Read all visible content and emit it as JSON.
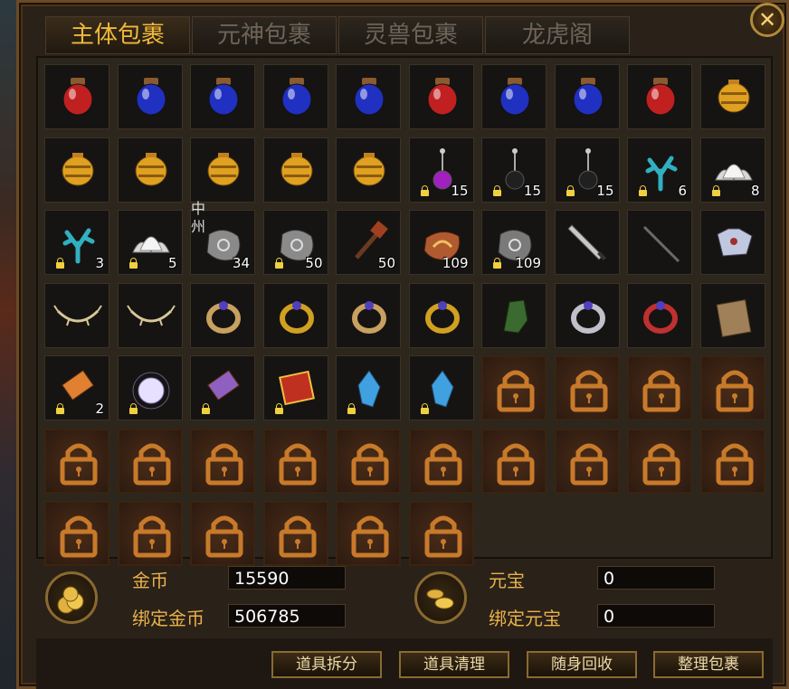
{
  "tabs": [
    "主体包裹",
    "元神包裹",
    "灵兽包裹",
    "龙虎阁"
  ],
  "active_tab": 0,
  "close_label": "✕",
  "items": [
    {
      "icon": "red-potion-icon",
      "color": "#c02020",
      "count": "",
      "bound": false
    },
    {
      "icon": "blue-potion-icon",
      "color": "#2030c0",
      "count": "",
      "bound": false
    },
    {
      "icon": "blue-potion-icon",
      "color": "#2030c0",
      "count": "",
      "bound": false
    },
    {
      "icon": "blue-potion-icon",
      "color": "#2030c0",
      "count": "",
      "bound": false
    },
    {
      "icon": "blue-potion-icon",
      "color": "#2030c0",
      "count": "",
      "bound": false
    },
    {
      "icon": "red-potion-icon",
      "color": "#c02020",
      "count": "",
      "bound": false
    },
    {
      "icon": "blue-potion-icon",
      "color": "#2030c0",
      "count": "",
      "bound": false
    },
    {
      "icon": "blue-potion-icon",
      "color": "#2030c0",
      "count": "",
      "bound": false
    },
    {
      "icon": "red-potion-icon",
      "color": "#c02020",
      "count": "",
      "bound": false
    },
    {
      "icon": "gold-jar-icon",
      "color": "#e0a020",
      "count": "",
      "bound": false
    },
    {
      "icon": "gold-jar-icon",
      "color": "#e0a020",
      "count": "",
      "bound": false
    },
    {
      "icon": "gold-jar-icon",
      "color": "#e0a020",
      "count": "",
      "bound": false
    },
    {
      "icon": "gold-jar-icon",
      "color": "#e0a020",
      "count": "",
      "bound": false
    },
    {
      "icon": "gold-jar-icon",
      "color": "#e0a020",
      "count": "",
      "bound": false
    },
    {
      "icon": "gold-jar-icon",
      "color": "#e0a020",
      "count": "",
      "bound": false
    },
    {
      "icon": "purple-flask-icon",
      "color": "#a020c0",
      "count": "15",
      "bound": true
    },
    {
      "icon": "black-flask-icon",
      "color": "#202020",
      "count": "15",
      "bound": true
    },
    {
      "icon": "black-flask-icon",
      "color": "#202020",
      "count": "15",
      "bound": true
    },
    {
      "icon": "coral-icon",
      "color": "#30b0c0",
      "count": "6",
      "bound": true
    },
    {
      "icon": "lotus-icon",
      "color": "#d8d8d8",
      "count": "8",
      "bound": true
    },
    {
      "icon": "coral-icon",
      "color": "#30b0c0",
      "count": "3",
      "bound": true
    },
    {
      "icon": "lotus-icon",
      "color": "#d8d8d8",
      "count": "5",
      "bound": true
    },
    {
      "icon": "stone-tablet-icon",
      "color": "#8a8a8a",
      "count": "34",
      "bound": false
    },
    {
      "icon": "stone-tablet-icon",
      "color": "#8a8a8a",
      "count": "50",
      "bound": true
    },
    {
      "icon": "hammer-icon",
      "color": "#a04020",
      "count": "50",
      "bound": false
    },
    {
      "icon": "orange-rune-stone-icon",
      "color": "#b05a30",
      "count": "109",
      "bound": false
    },
    {
      "icon": "gray-rune-stone-icon",
      "color": "#7a7a7a",
      "count": "109",
      "bound": true
    },
    {
      "icon": "sword-icon",
      "color": "#c8c8c8",
      "count": "",
      "bound": false
    },
    {
      "icon": "staff-icon",
      "color": "#6a6a6a",
      "count": "",
      "bound": false
    },
    {
      "icon": "armor-icon",
      "color": "#c0c8e0",
      "count": "",
      "bound": false
    },
    {
      "icon": "thorn-necklace-icon",
      "color": "#d8c898",
      "count": "",
      "bound": false
    },
    {
      "icon": "thorn-necklace-icon",
      "color": "#d8c898",
      "count": "",
      "bound": false
    },
    {
      "icon": "skull-ring-icon",
      "color": "#c8a060",
      "count": "",
      "bound": false
    },
    {
      "icon": "gold-ring-icon",
      "color": "#d0a020",
      "count": "",
      "bound": false
    },
    {
      "icon": "skull-ring-icon",
      "color": "#c8a060",
      "count": "",
      "bound": false
    },
    {
      "icon": "gold-bracelet-icon",
      "color": "#d0a020",
      "count": "",
      "bound": false
    },
    {
      "icon": "gauntlet-icon",
      "color": "#3a6a30",
      "count": "",
      "bound": false
    },
    {
      "icon": "silver-bracelet-icon",
      "color": "#c0c0c8",
      "count": "",
      "bound": false
    },
    {
      "icon": "red-bracelet-icon",
      "color": "#c03030",
      "count": "",
      "bound": false
    },
    {
      "icon": "scroll-board-icon",
      "color": "#a08058",
      "count": "",
      "bound": false
    },
    {
      "icon": "scroll-icon",
      "color": "#e08030",
      "count": "2",
      "bound": true
    },
    {
      "icon": "white-orb-icon",
      "color": "#e8e0ff",
      "count": "",
      "bound": true
    },
    {
      "icon": "purple-scroll-icon",
      "color": "#9060c0",
      "count": "",
      "bound": true
    },
    {
      "icon": "red-book-icon",
      "color": "#c03020",
      "count": "",
      "bound": true
    },
    {
      "icon": "blue-crystal-icon",
      "color": "#40a0e0",
      "count": "",
      "bound": true
    },
    {
      "icon": "blue-crystal-icon",
      "color": "#40a0e0",
      "count": "",
      "bound": true
    }
  ],
  "slot_text": {
    "22": "中州"
  },
  "locked_slots": 20,
  "currency": {
    "gold_label": "金币",
    "gold_value": "15590",
    "bound_gold_label": "绑定金币",
    "bound_gold_value": "506785",
    "ingot_label": "元宝",
    "ingot_value": "0",
    "bound_ingot_label": "绑定元宝",
    "bound_ingot_value": "0"
  },
  "buttons": [
    "道具拆分",
    "道具清理",
    "随身回收",
    "整理包裹"
  ]
}
